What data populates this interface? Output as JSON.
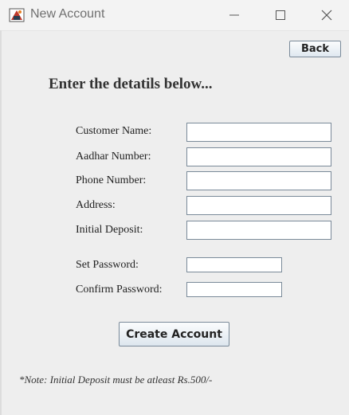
{
  "window": {
    "title": "New Account"
  },
  "toolbar": {
    "back_label": "Back"
  },
  "form": {
    "heading": "Enter the detatils below...",
    "customer_name": {
      "label": "Customer Name:",
      "value": ""
    },
    "aadhar_number": {
      "label": "Aadhar Number:",
      "value": ""
    },
    "phone_number": {
      "label": "Phone Number:",
      "value": ""
    },
    "address": {
      "label": "Address:",
      "value": ""
    },
    "initial_deposit": {
      "label": "Initial Deposit:",
      "value": ""
    },
    "set_password": {
      "label": "Set Password:",
      "value": ""
    },
    "confirm_password": {
      "label": "Confirm Password:",
      "value": ""
    },
    "submit_label": "Create Account",
    "note": "*Note: Initial Deposit must be atleast Rs.500/-"
  },
  "icons": {
    "app": "java-app-icon",
    "minimize": "minimize-icon",
    "maximize": "maximize-icon",
    "close": "close-icon"
  }
}
